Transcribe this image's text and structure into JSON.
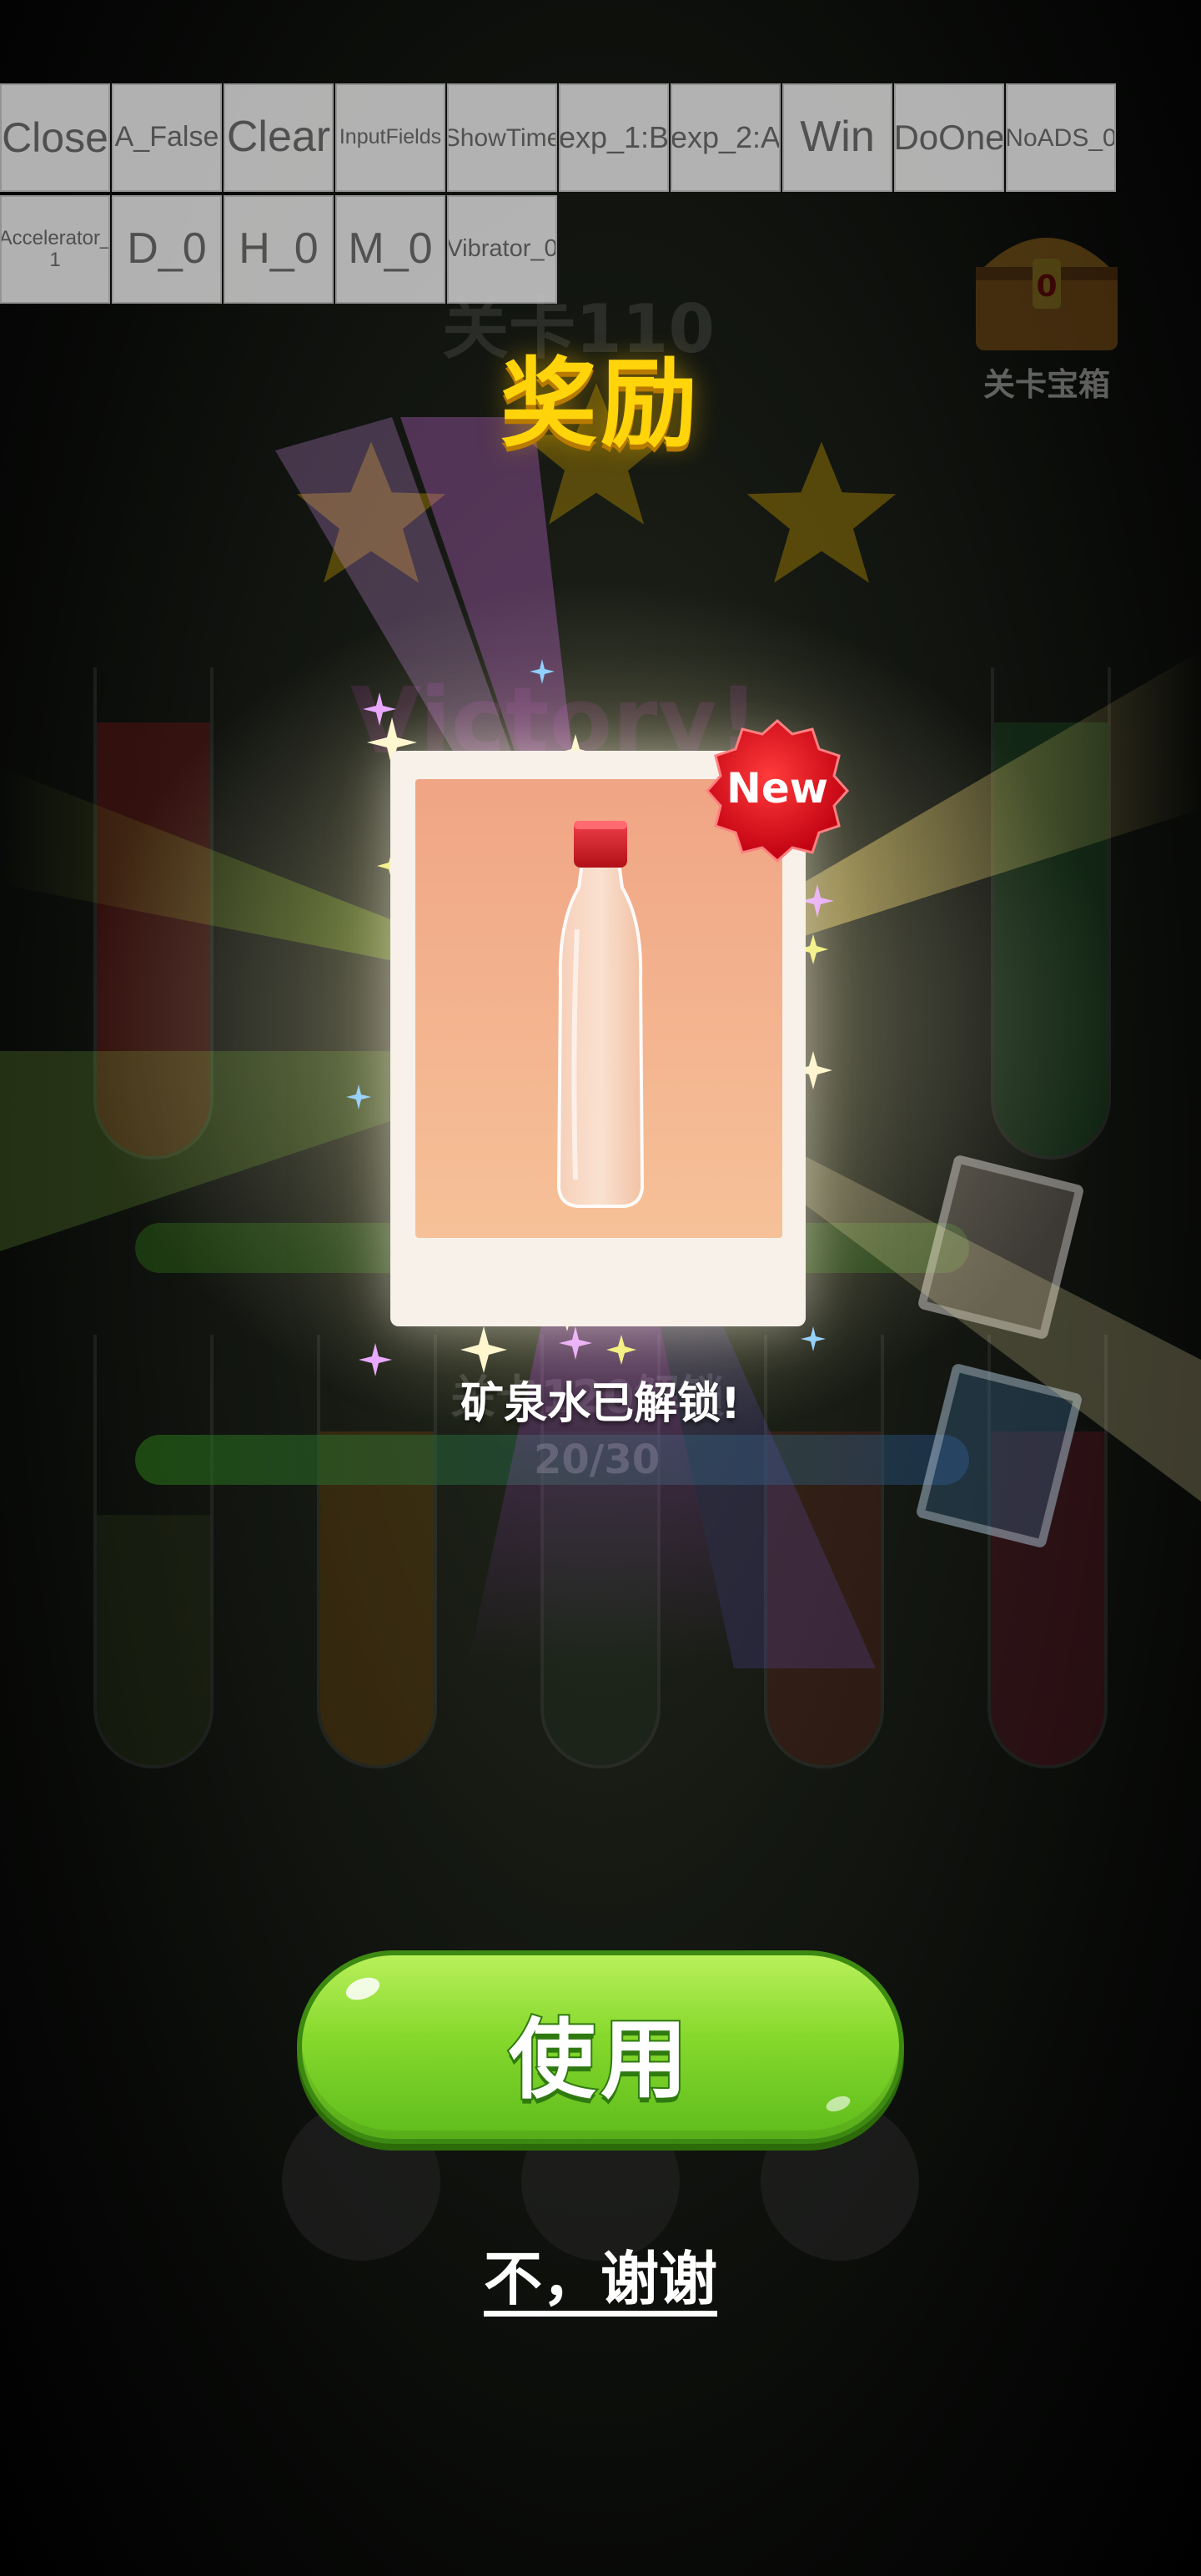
{
  "debug_toolbar": {
    "row1": [
      "Close",
      "A_False",
      "Clear",
      "InputFields",
      "ShowTime",
      "exp_1:B",
      "exp_2:A",
      "Win",
      "DoOne",
      "NoADS_0"
    ],
    "row2": [
      "Accelerator_\n1",
      "D_0",
      "H_0",
      "M_0",
      "Vibrator_0"
    ]
  },
  "background": {
    "level_title": "关卡110",
    "victory_text": "Victory!",
    "progress_1_label": "关卡120解锁",
    "progress_2_label": "20/30",
    "chest_count": "0",
    "chest_label": "关卡宝箱"
  },
  "reward": {
    "title": "奖励",
    "new_badge": "New",
    "item_icon": "mineral-water-bottle-icon",
    "unlock_message": "矿泉水已解锁!"
  },
  "actions": {
    "use_label": "使用",
    "decline_label": "不，谢谢"
  },
  "colors": {
    "title": "#ffd40a",
    "use_button": "#86d82c",
    "badge": "#e01018",
    "card_bg": "#f7f1ea"
  }
}
